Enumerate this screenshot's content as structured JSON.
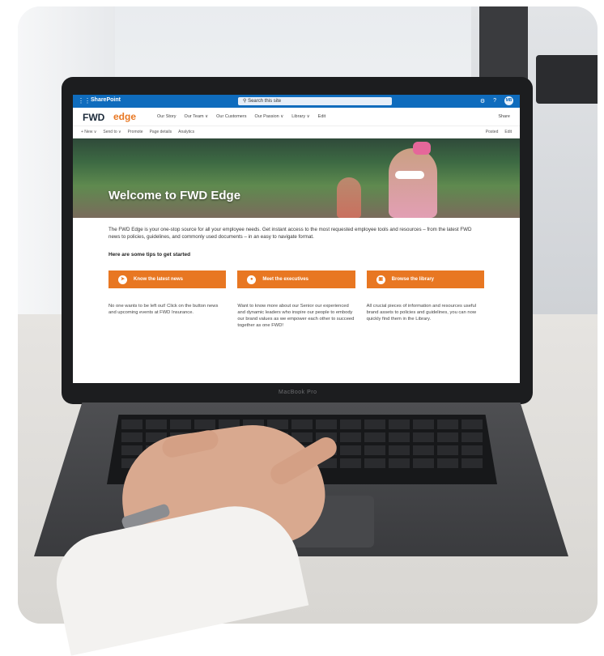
{
  "sharepoint": {
    "app_name": "SharePoint",
    "search_placeholder": "Search this site",
    "avatar_initials": "MB",
    "settings_icon": "gear-icon",
    "help_icon": "question-icon"
  },
  "site": {
    "logo": "FWD",
    "name": "edge",
    "nav": [
      "Our Story",
      "Our Team ∨",
      "Our Customers",
      "Our Passion ∨",
      "Library ∨",
      "Edit"
    ],
    "share_label": "Share"
  },
  "commandbar": {
    "items": [
      "+ New ∨",
      "Send to ∨",
      "Promote",
      "Page details",
      "Analytics"
    ],
    "right": [
      "Posted",
      "Edit"
    ]
  },
  "hero": {
    "title": "Welcome to FWD Edge"
  },
  "content": {
    "intro": "The FWD Edge is your one-stop source for all your employee needs. Get instant access to the most requested employee tools and resources – from the latest FWD news to policies, guidelines, and commonly used documents – in an easy to navigate format.",
    "tips_heading": "Here are some tips to get started",
    "cards": [
      {
        "label": "Know the latest news",
        "icon": "megaphone-icon",
        "desc": "No one wants to be left out! Click on the button news and upcoming events at FWD Insurance."
      },
      {
        "label": "Meet the executives",
        "icon": "person-icon",
        "desc": "Want to know more about our Senior our experienced and dynamic leaders who inspire our people to embody our brand values as we empower each other to succeed together as one FWD!"
      },
      {
        "label": "Browse the library",
        "icon": "presentation-icon",
        "desc": "All crucial pieces of information and resources useful brand assets to policies and guidelines, you can now quickly find them in the Library."
      }
    ]
  },
  "laptop": {
    "brand": "MacBook Pro"
  },
  "colors": {
    "accent": "#e87722",
    "sharepoint_blue": "#0f6cbd"
  }
}
